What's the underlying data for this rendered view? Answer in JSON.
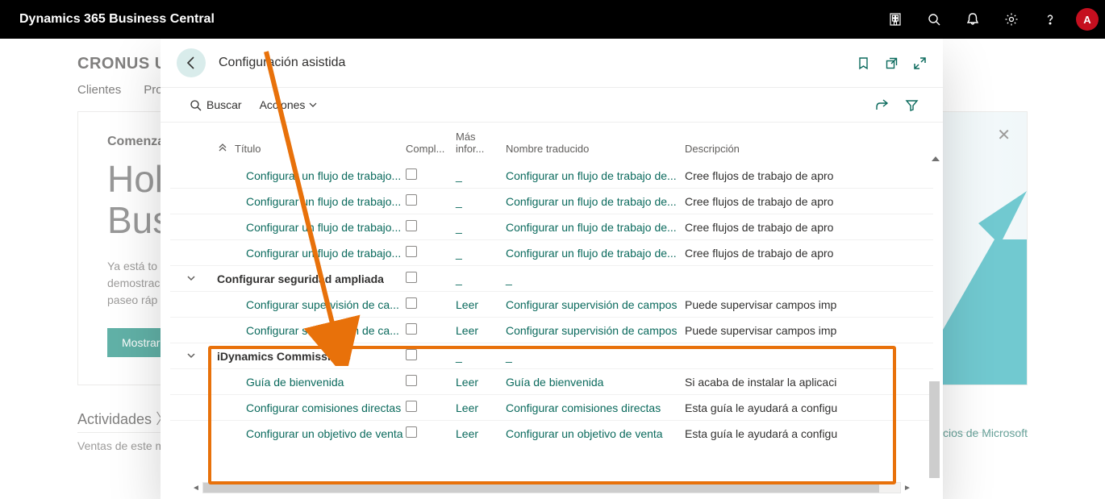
{
  "topbar": {
    "brand": "Dynamics 365 Business Central",
    "avatar": "A"
  },
  "background": {
    "company": "CRONUS US",
    "nav": [
      "Clientes",
      "Pro"
    ],
    "start_heading": "Comenza",
    "big_line1": "Hola",
    "big_line2": "Bus",
    "subtext1": "Ya está to",
    "subtext2": "demostrac",
    "subtext3": "paseo ráp",
    "show_btn": "Mostrar",
    "activities": "Actividades",
    "ventas": "Ventas de este m",
    "mslink": "rvicios de Microsoft"
  },
  "modal": {
    "title": "Configuración asistida",
    "search": "Buscar",
    "actions": "Acciones",
    "columns": {
      "title": "Título",
      "comp": "Compl...",
      "info1": "Más",
      "info2": "infor...",
      "name": "Nombre traducido",
      "desc": "Descripción"
    },
    "rows": [
      {
        "type": "item",
        "title": "Configurar un flujo de trabajo...",
        "info": "_",
        "name": "Configurar un flujo de trabajo de...",
        "desc": "Cree flujos de trabajo de apro"
      },
      {
        "type": "item",
        "title": "Configurar un flujo de trabajo...",
        "info": "_",
        "name": "Configurar un flujo de trabajo de...",
        "desc": "Cree flujos de trabajo de apro"
      },
      {
        "type": "item",
        "title": "Configurar un flujo de trabajo...",
        "info": "_",
        "name": "Configurar un flujo de trabajo de...",
        "desc": "Cree flujos de trabajo de apro"
      },
      {
        "type": "item",
        "title": "Configurar un flujo de trabajo...",
        "info": "_",
        "name": "Configurar un flujo de trabajo de...",
        "desc": "Cree flujos de trabajo de apro"
      },
      {
        "type": "group",
        "title": "Configurar seguridad ampliada",
        "info": "_",
        "name": "_",
        "desc": ""
      },
      {
        "type": "item",
        "title": "Configurar supervisión de ca...",
        "info": "Leer",
        "name": "Configurar supervisión de campos",
        "desc": "Puede supervisar campos imp"
      },
      {
        "type": "item",
        "title": "Configurar supervisión de ca...",
        "info": "Leer",
        "name": "Configurar supervisión de campos",
        "desc": "Puede supervisar campos imp"
      },
      {
        "type": "group",
        "title": "iDynamics Commissions",
        "info": "_",
        "name": "_",
        "desc": ""
      },
      {
        "type": "item",
        "title": "Guía de bienvenida",
        "info": "Leer",
        "name": "Guía de bienvenida",
        "desc": "Si acaba de instalar la aplicaci"
      },
      {
        "type": "item",
        "title": "Configurar comisiones directas",
        "info": "Leer",
        "name": "Configurar comisiones directas",
        "desc": "Esta guía le ayudará a configu"
      },
      {
        "type": "item",
        "title": "Configurar un objetivo de venta",
        "info": "Leer",
        "name": "Configurar un objetivo de venta",
        "desc": "Esta guía le ayudará a configu"
      }
    ]
  }
}
